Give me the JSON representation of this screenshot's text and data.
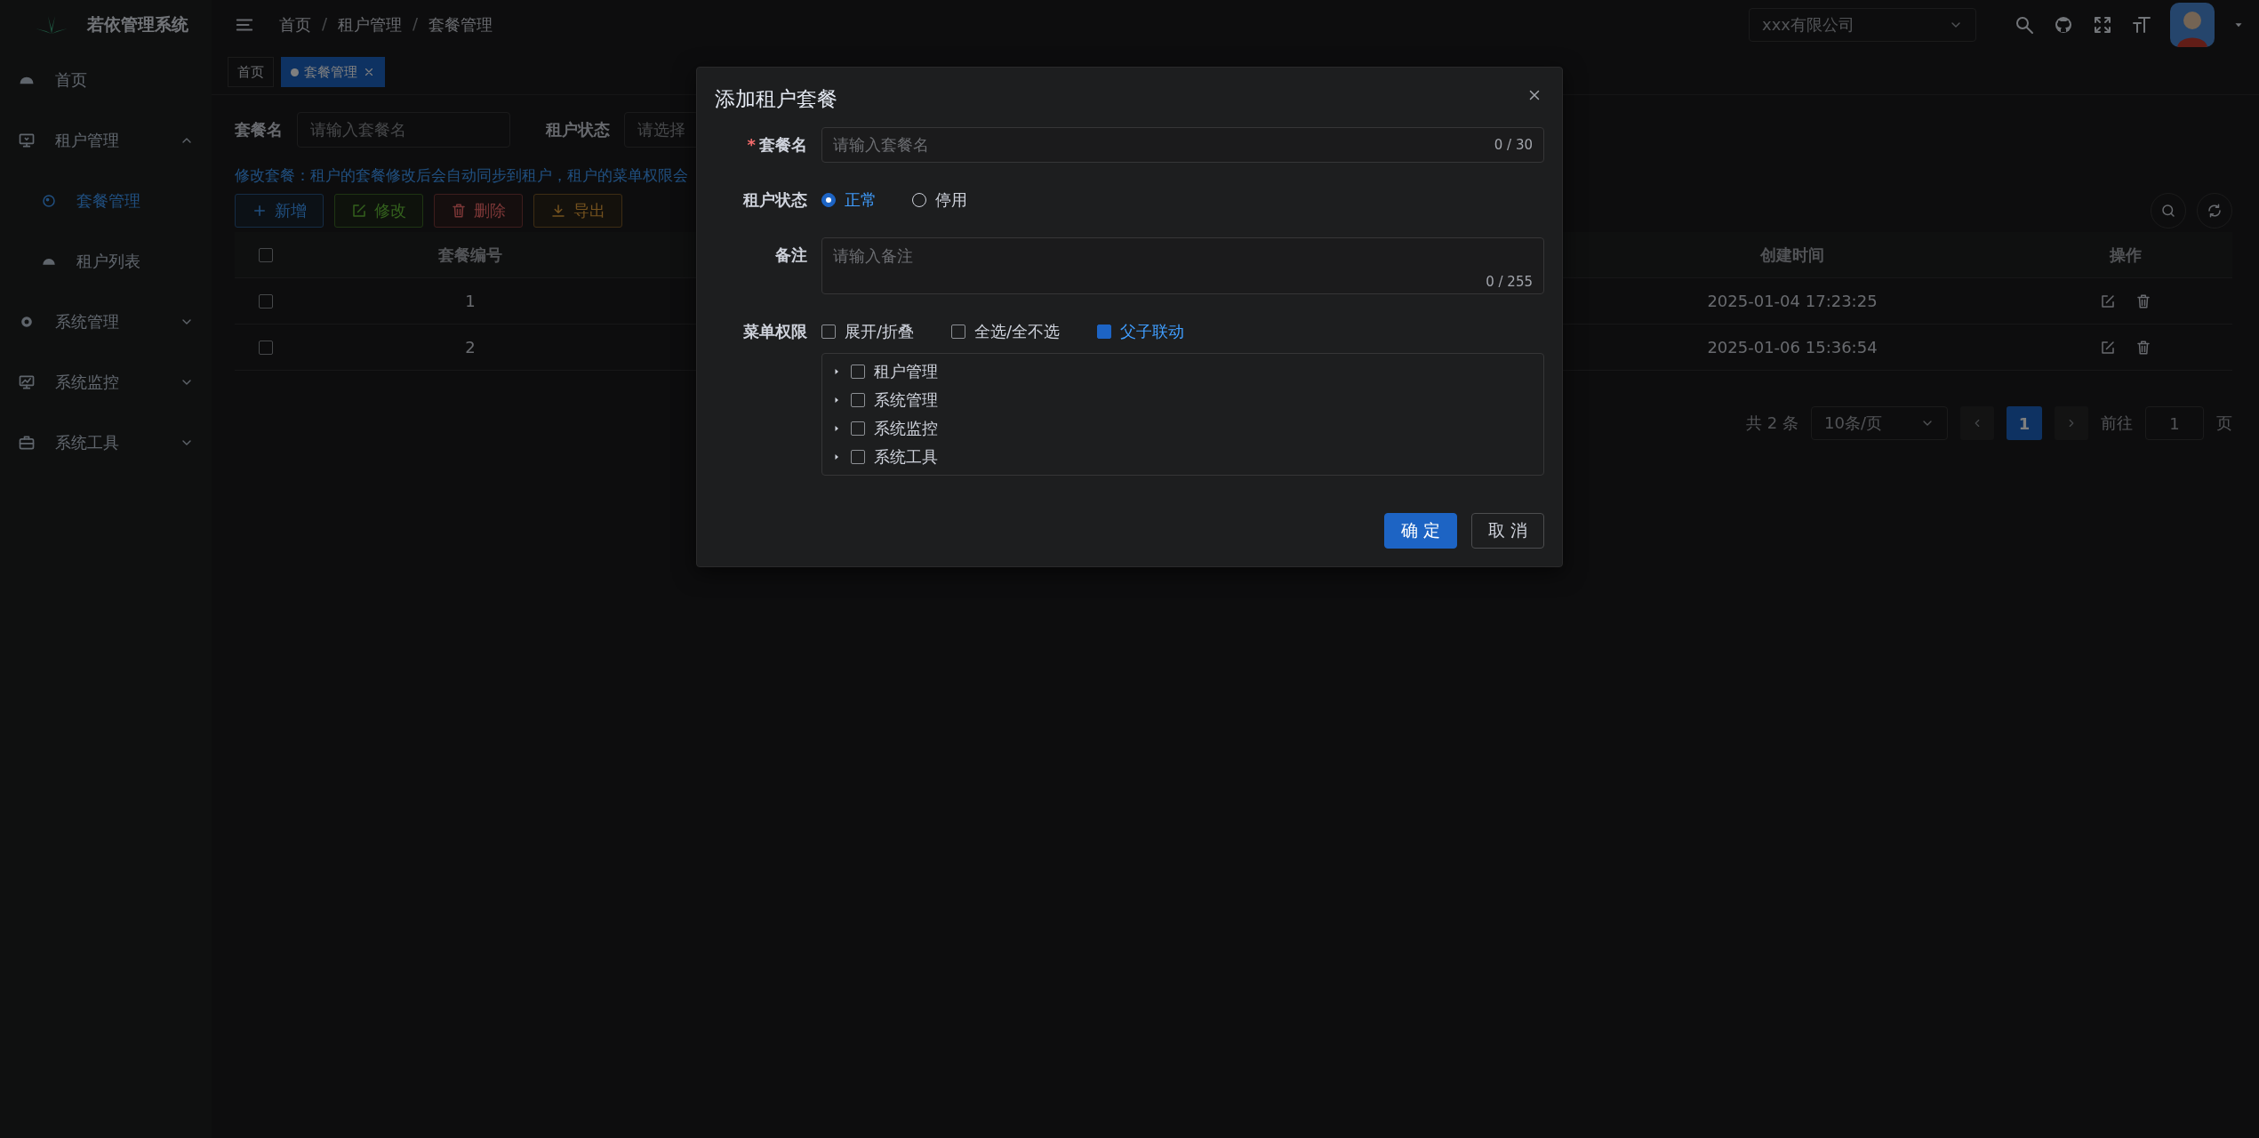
{
  "app": {
    "title": "若依管理系统"
  },
  "sidebar": {
    "items": [
      {
        "label": "首页",
        "kind": "link",
        "selected": false
      },
      {
        "label": "租户管理",
        "kind": "group",
        "expanded": true,
        "children": [
          {
            "label": "套餐管理",
            "selected": true
          },
          {
            "label": "租户列表",
            "selected": false
          }
        ]
      },
      {
        "label": "系统管理",
        "kind": "group",
        "expanded": false
      },
      {
        "label": "系统监控",
        "kind": "group",
        "expanded": false
      },
      {
        "label": "系统工具",
        "kind": "group",
        "expanded": false
      }
    ]
  },
  "header": {
    "breadcrumb": [
      "首页",
      "租户管理",
      "套餐管理"
    ],
    "breadcrumb_separator": "/",
    "tenant_select": {
      "value": "xxx有限公司"
    }
  },
  "tags": [
    {
      "label": "首页",
      "selected": false,
      "closable": false
    },
    {
      "label": "套餐管理",
      "selected": true,
      "closable": true
    }
  ],
  "search": {
    "fields": [
      {
        "label": "套餐名",
        "placeholder": "请输入套餐名"
      },
      {
        "label": "租户状态",
        "placeholder": "请选择"
      }
    ]
  },
  "notice": "修改套餐：租户的套餐修改后会自动同步到租户，租户的菜单权限会",
  "toolbar": [
    {
      "label": "新增",
      "kind": "primary"
    },
    {
      "label": "修改",
      "kind": "success"
    },
    {
      "label": "删除",
      "kind": "danger"
    },
    {
      "label": "导出",
      "kind": "warning"
    }
  ],
  "table": {
    "header_checked": false,
    "columns": [
      "套餐编号",
      "创建时间",
      "操作"
    ],
    "rows": [
      {
        "selected": false,
        "id": "1",
        "created": "2025-01-04 17:23:25"
      },
      {
        "selected": false,
        "id": "2",
        "created": "2025-01-06 15:36:54"
      }
    ]
  },
  "pagination": {
    "total": "共 2 条",
    "page_size": "10条/页",
    "pages": [
      {
        "label": "1",
        "selected": true
      }
    ],
    "goto_label": "前往",
    "goto_value": "1",
    "page_suffix": "页"
  },
  "dialog": {
    "title": "添加租户套餐",
    "name": {
      "label": "套餐名",
      "required_mark": "*",
      "placeholder": "请输入套餐名",
      "counter": "0 / 30"
    },
    "status": {
      "label": "租户状态",
      "options": [
        {
          "label": "正常",
          "selected": true
        },
        {
          "label": "停用",
          "selected": false
        }
      ]
    },
    "remark": {
      "label": "备注",
      "placeholder": "请输入备注",
      "counter": "0 / 255"
    },
    "menu": {
      "label": "菜单权限",
      "options": [
        {
          "label": "展开/折叠",
          "checked": false
        },
        {
          "label": "全选/全不选",
          "checked": false
        },
        {
          "label": "父子联动",
          "checked": true
        }
      ],
      "tree": [
        {
          "label": "租户管理",
          "checked": false,
          "expanded": false
        },
        {
          "label": "系统管理",
          "checked": false,
          "expanded": false
        },
        {
          "label": "系统监控",
          "checked": false,
          "expanded": false
        },
        {
          "label": "系统工具",
          "checked": false,
          "expanded": false
        }
      ]
    },
    "buttons": [
      {
        "label": "确 定",
        "kind": "primary"
      },
      {
        "label": "取 消",
        "kind": "default"
      }
    ]
  }
}
